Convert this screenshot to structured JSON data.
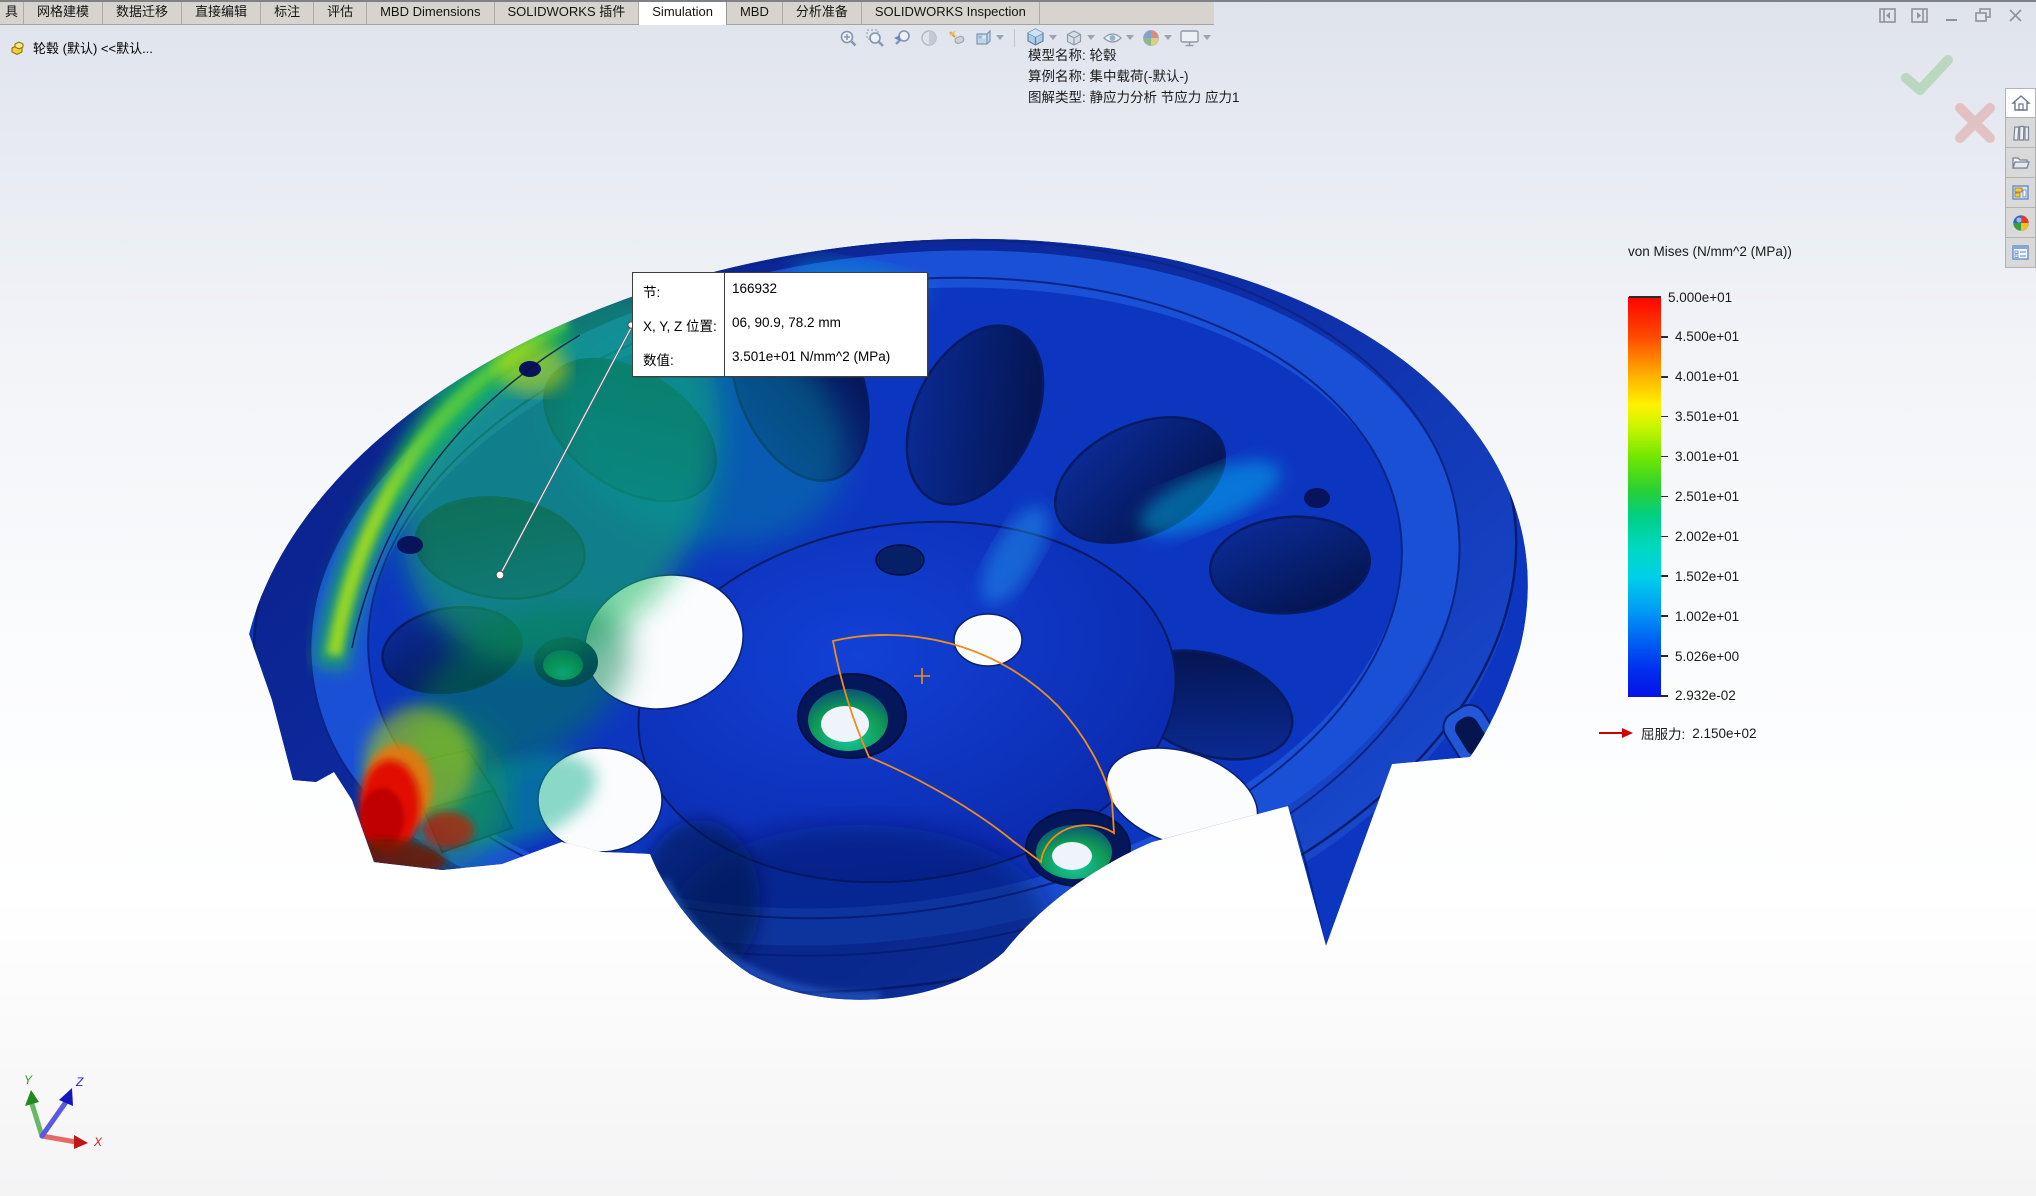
{
  "window": {
    "controls": [
      {
        "name": "collapse-pane-left"
      },
      {
        "name": "collapse-pane-right"
      },
      {
        "name": "minimize"
      },
      {
        "name": "restore"
      },
      {
        "name": "close"
      }
    ]
  },
  "command_tabs": {
    "items": [
      {
        "label": "具"
      },
      {
        "label": "网格建模"
      },
      {
        "label": "数据迁移"
      },
      {
        "label": "直接编辑"
      },
      {
        "label": "标注"
      },
      {
        "label": "评估"
      },
      {
        "label": "MBD Dimensions"
      },
      {
        "label": "SOLIDWORKS 插件"
      },
      {
        "label": "Simulation",
        "active": true
      },
      {
        "label": "MBD"
      },
      {
        "label": "分析准备"
      },
      {
        "label": "SOLIDWORKS Inspection"
      }
    ]
  },
  "feature_tree": {
    "root_label": "轮毂 (默认) <<默认..."
  },
  "heads_up_toolbar": {
    "tools": [
      "zoom-to-fit",
      "zoom-to-area",
      "previous-view",
      "section-view",
      "dynamic-annotation",
      "edit-appearance",
      "view-orientation",
      "display-style",
      "hide-show-items",
      "appearances",
      "view-settings"
    ]
  },
  "plot_header": {
    "lines": [
      "模型名称: 轮毂",
      "算例名称: 集中载荷(-默认-)",
      "图解类型: 静应力分析 节应力 应力1"
    ]
  },
  "probe_callout": {
    "rows": [
      {
        "label": "节:",
        "value": "166932"
      },
      {
        "label": "X, Y, Z 位置:",
        "value": "06, 90.9, 78.2 mm"
      },
      {
        "label": "数值:",
        "value": "3.501e+01 N/mm^2 (MPa)"
      }
    ]
  },
  "legend": {
    "title": "von Mises (N/mm^2 (MPa))",
    "ticks": [
      "5.000e+01",
      "4.500e+01",
      "4.001e+01",
      "3.501e+01",
      "3.001e+01",
      "2.501e+01",
      "2.002e+01",
      "1.502e+01",
      "1.002e+01",
      "5.026e+00",
      "2.932e-02"
    ],
    "yield_label": "屈服力:",
    "yield_value": "2.150e+02",
    "gradient_top_to_bottom": [
      "#fb0300",
      "#ffb400",
      "#fff200",
      "#72e600",
      "#00cf87",
      "#00cfe8",
      "#009ef5",
      "#0611e8"
    ]
  },
  "task_pane": {
    "items": [
      "home",
      "design-library",
      "file-explorer",
      "view-palette",
      "appearances",
      "custom-properties"
    ]
  },
  "triad": {
    "axes": [
      {
        "label": "Y",
        "color": "#1e9e1e"
      },
      {
        "label": "Z",
        "color": "#2323d6"
      },
      {
        "label": "X",
        "color": "#d62323"
      }
    ]
  },
  "colors": {
    "model_base_blue": "#0d36c0",
    "hotspot_red": "#c00300",
    "sketch_orange": "#f08c1e",
    "tab_active_bg": "#ffffff",
    "tabbar_bg": "#d7d4d0"
  }
}
